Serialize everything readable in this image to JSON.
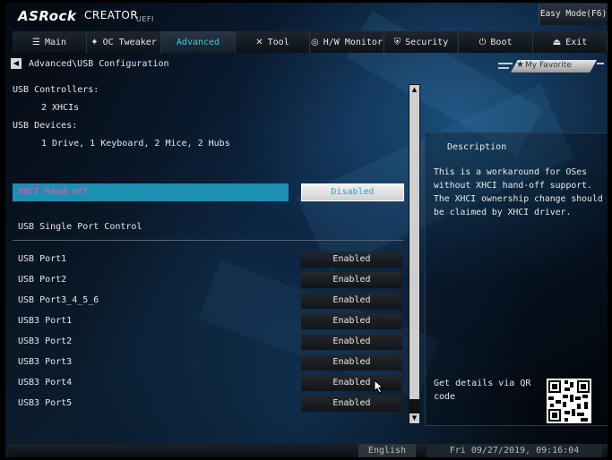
{
  "brand": {
    "logo": "ASRock",
    "product": "CREATOR",
    "firmware": "UEFI"
  },
  "header": {
    "easy_mode": "Easy Mode(F6)"
  },
  "tabs": [
    {
      "label": "Main",
      "icon": "☰"
    },
    {
      "label": "OC Tweaker",
      "icon": "✦"
    },
    {
      "label": "Advanced",
      "icon": ""
    },
    {
      "label": "Tool",
      "icon": "✕"
    },
    {
      "label": "H/W Monitor",
      "icon": "◎"
    },
    {
      "label": "Security",
      "icon": "⛨"
    },
    {
      "label": "Boot",
      "icon": "⏻"
    },
    {
      "label": "Exit",
      "icon": "⏏"
    }
  ],
  "active_tab": "Advanced",
  "breadcrumb": "Advanced\\USB Configuration",
  "favorite": {
    "label": "My Favorite"
  },
  "info": {
    "controllers_label": "USB Controllers:",
    "controllers_value": "2 XHCIs",
    "devices_label": "USB Devices:",
    "devices_value": "1 Drive, 1 Keyboard, 2 Mice, 2 Hubs"
  },
  "settings": {
    "xhci_handoff": {
      "label": "XHCI Hand-off",
      "value": "Disabled"
    },
    "single_port_control": {
      "label": "USB Single Port Control"
    },
    "ports": [
      {
        "label": "USB Port1",
        "value": "Enabled"
      },
      {
        "label": "USB Port2",
        "value": "Enabled"
      },
      {
        "label": "USB Port3_4_5_6",
        "value": "Enabled"
      },
      {
        "label": "USB3 Port1",
        "value": "Enabled"
      },
      {
        "label": "USB3 Port2",
        "value": "Enabled"
      },
      {
        "label": "USB3 Port3",
        "value": "Enabled"
      },
      {
        "label": "USB3 Port4",
        "value": "Enabled"
      },
      {
        "label": "USB3 Port5",
        "value": "Enabled"
      }
    ]
  },
  "description": {
    "title": "Description",
    "text": "This is a workaround for OSes without XHCI hand-off support. The XHCI ownership change should be claimed by XHCI driver.",
    "qr_label": "Get details via QR code"
  },
  "footer": {
    "language": "English",
    "datetime": "Fri 09/27/2019, 09:16:04"
  },
  "colors": {
    "accent": "#3fc9e6",
    "highlight_bar": "#1d8fb0",
    "selected_label": "#ff4fa6"
  }
}
